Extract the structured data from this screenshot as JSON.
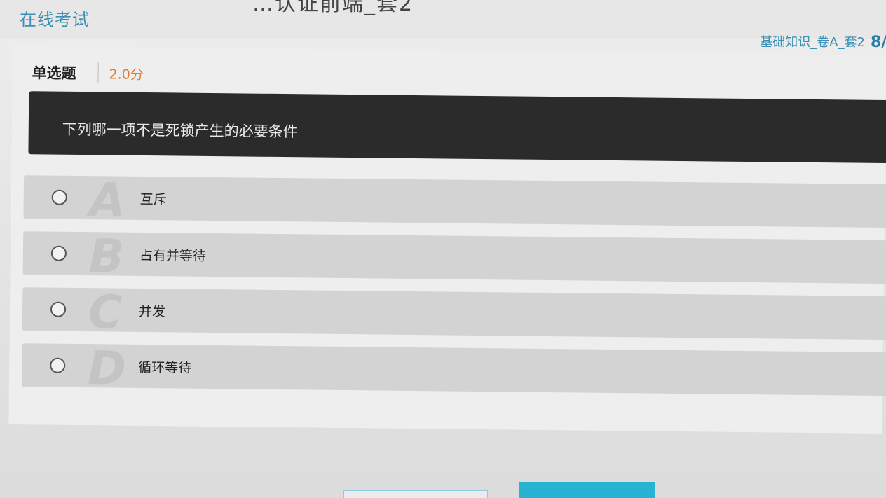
{
  "header": {
    "app_title": "在线考试",
    "exam_heading": "…认证前端_套2",
    "paper_name": "基础知识_卷A_套2",
    "page_indicator": "8/"
  },
  "question": {
    "type_label": "单选题",
    "score": "2.0分",
    "text": "下列哪一项不是死锁产生的必要条件",
    "options": [
      {
        "letter": "A",
        "text": "互斥"
      },
      {
        "letter": "B",
        "text": "占有并等待"
      },
      {
        "letter": "C",
        "text": "并发"
      },
      {
        "letter": "D",
        "text": "循环等待"
      }
    ]
  },
  "colors": {
    "accent": "#3a8fb3",
    "score": "#e07a2e",
    "question_bg": "#2b2b2b",
    "option_bg": "#d3d3d3",
    "primary_button": "#27b3d1"
  }
}
